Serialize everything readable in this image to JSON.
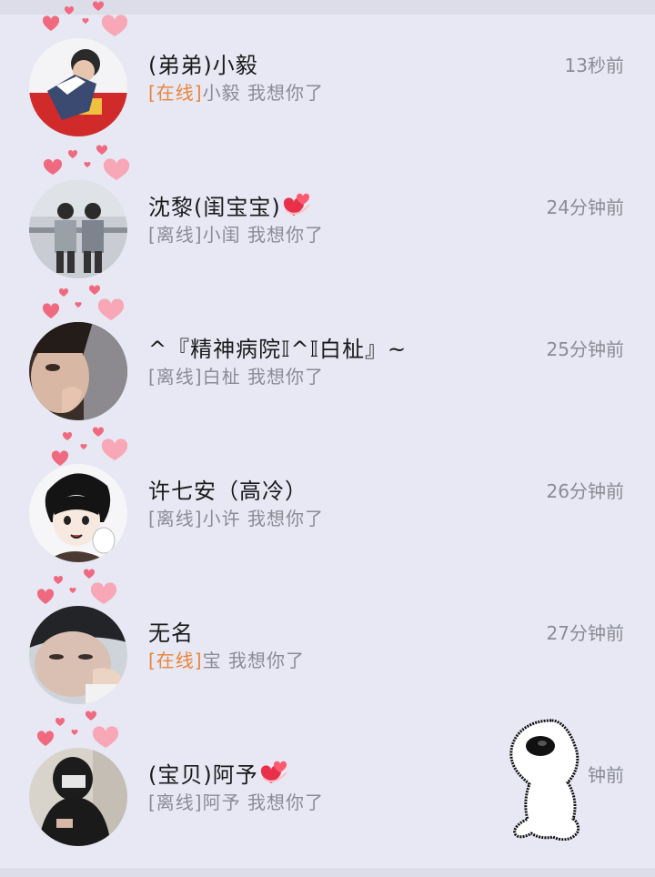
{
  "contacts": [
    {
      "name": "(弟弟)小毅",
      "status": "[在线]",
      "online": true,
      "message": "小毅 我想你了",
      "time": "13秒前",
      "sticker": false
    },
    {
      "name": "沈黎(闺宝宝)",
      "status": "[离线]",
      "online": false,
      "message": "小闺 我想你了",
      "time": "24分钟前",
      "sticker": true
    },
    {
      "name": "^『精神病院𝕀^𝕀白杫』~",
      "status": "[离线]",
      "online": false,
      "message": "白杫 我想你了",
      "time": "25分钟前",
      "sticker": false
    },
    {
      "name": "许七安（高冷）",
      "status": "[离线]",
      "online": false,
      "message": "小许 我想你了",
      "time": "26分钟前",
      "sticker": false
    },
    {
      "name": "无名",
      "status": "[在线]",
      "online": true,
      "message": "宝 我想你了",
      "time": "27分钟前",
      "sticker": false
    },
    {
      "name": "(宝贝)阿予",
      "status": "[离线]",
      "online": false,
      "message": "阿予 我想你了",
      "time": "钟前",
      "sticker": true
    }
  ],
  "icons": {
    "avatar": "avatar-photo",
    "hearts": "heart-decoration-icon",
    "sticker": "heart-sticker-icon",
    "overlay": "ghost-sticker-icon"
  },
  "colors": {
    "background": "#e7e8f4",
    "online_status": "#e9843a",
    "offline_status": "#8a8b95",
    "heart": "#f06a7f"
  }
}
